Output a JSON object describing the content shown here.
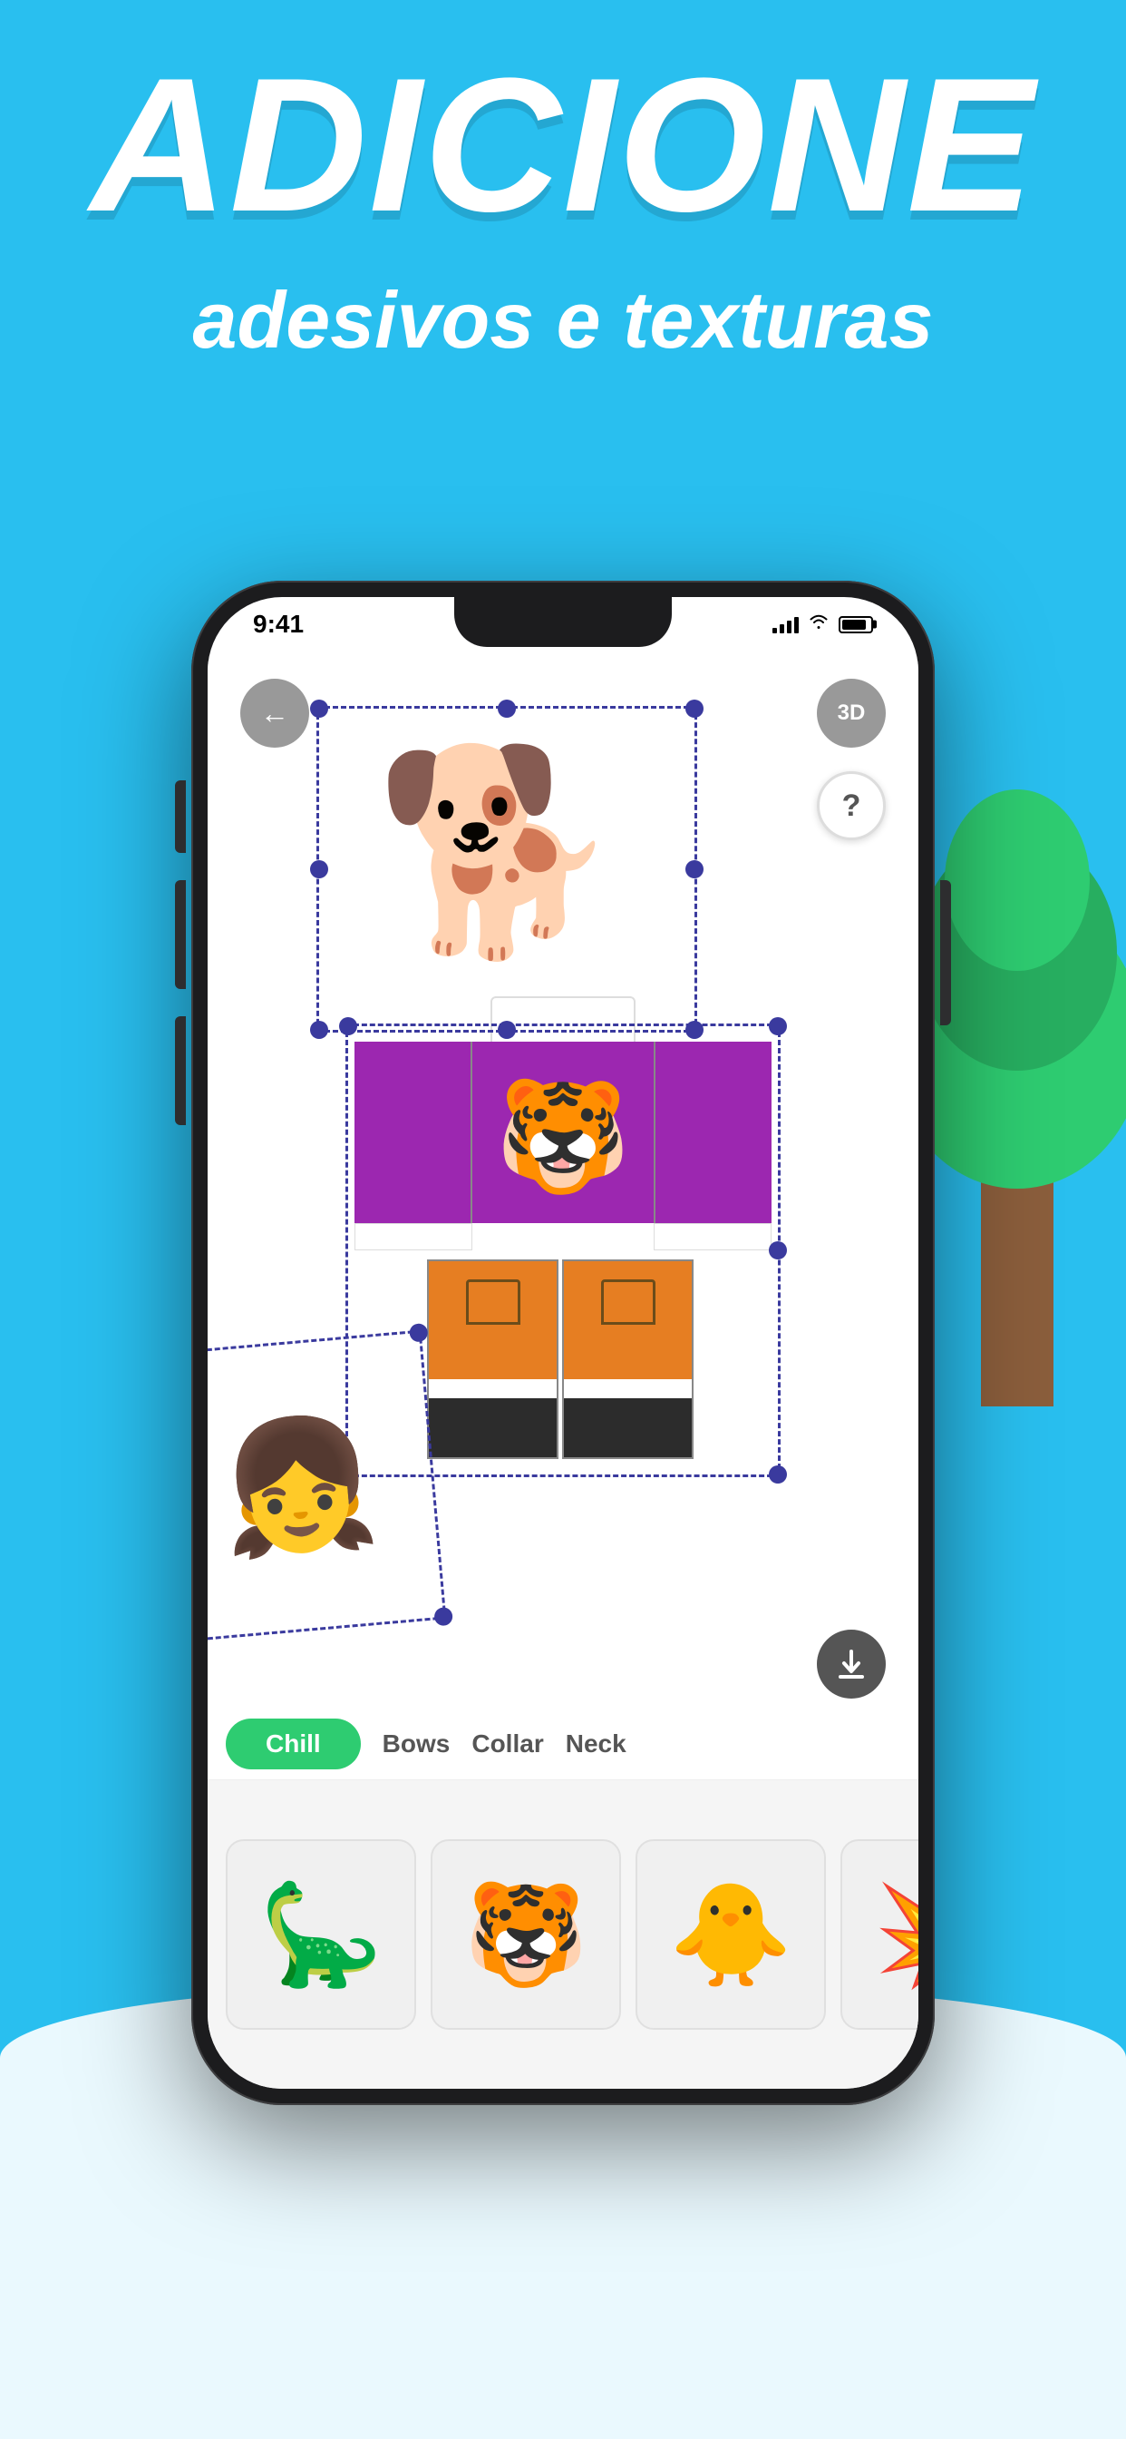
{
  "header": {
    "main_title": "ADICIONE",
    "subtitle": "adesivos e texturas"
  },
  "status_bar": {
    "time": "9:41",
    "signal": "signal",
    "wifi": "wifi",
    "battery": "battery"
  },
  "app": {
    "back_button": "←",
    "btn_3d_label": "3D",
    "btn_help_label": "?",
    "download_label": "↓"
  },
  "sticker_categories": [
    {
      "label": "Chill",
      "active": true
    },
    {
      "label": "Bows",
      "active": false
    },
    {
      "label": "Collar",
      "active": false
    },
    {
      "label": "Neck",
      "active": false
    }
  ],
  "stickers": [
    {
      "emoji": "🦕",
      "name": "dinosaur"
    },
    {
      "emoji": "🐯",
      "name": "tiger"
    },
    {
      "emoji": "🐥",
      "name": "duck"
    },
    {
      "emoji": "💥",
      "name": "explosion"
    }
  ],
  "colors": {
    "background": "#29bfef",
    "active_tab": "#2ecc71",
    "shirt_purple": "#9c27b0",
    "pants_orange": "#e67e22",
    "dark_handle": "#3a3a9e"
  }
}
